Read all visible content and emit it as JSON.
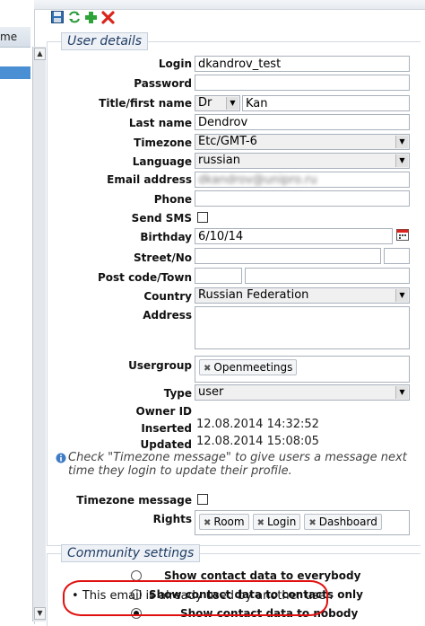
{
  "sidebar": {
    "header_label": "me"
  },
  "toolbar": {
    "icons": [
      "save-icon",
      "refresh-icon",
      "add-icon",
      "delete-icon"
    ]
  },
  "user_details": {
    "legend": "User details",
    "labels": {
      "login": "Login",
      "password": "Password",
      "title_first_name": "Title/first name",
      "last_name": "Last name",
      "timezone": "Timezone",
      "language": "Language",
      "email": "Email address",
      "phone": "Phone",
      "send_sms": "Send SMS",
      "birthday": "Birthday",
      "street_no": "Street/No",
      "post_code_town": "Post code/Town",
      "country": "Country",
      "address": "Address",
      "usergroup": "Usergroup",
      "type": "Type",
      "owner_id": "Owner ID",
      "inserted": "Inserted",
      "updated": "Updated",
      "timezone_message": "Timezone message",
      "rights": "Rights"
    },
    "values": {
      "login": "dkandrov_test",
      "password": "",
      "title": "Dr",
      "first_name": "Kan",
      "last_name": "Dendrov",
      "timezone": "Etc/GMT-6",
      "language": "russian",
      "email": "dkandrov@unipro.ru",
      "phone": "",
      "birthday": "6/10/14",
      "street": "",
      "house_no": "",
      "post_code": "",
      "town": "",
      "country": "Russian Federation",
      "address": "",
      "usergroups": [
        "Openmeetings"
      ],
      "type": "user",
      "owner_id": "",
      "inserted": "12.08.2014 14:32:52",
      "updated": "12.08.2014 15:08:05",
      "rights": [
        "Room",
        "Login",
        "Dashboard"
      ]
    },
    "info_note": "Check \"Timezone message\" to give users a message next time they login to update their profile."
  },
  "community_settings": {
    "legend": "Community settings",
    "options": [
      "Show contact data to everybody",
      "Show contact data to contacts only",
      "Show contact data to nobody"
    ],
    "selected_index": 2
  },
  "error_message": "This email is already used by another user.",
  "colors": {
    "accent": "#1f3b63",
    "selection": "#4a8fd4",
    "error_outline": "#e01010"
  }
}
